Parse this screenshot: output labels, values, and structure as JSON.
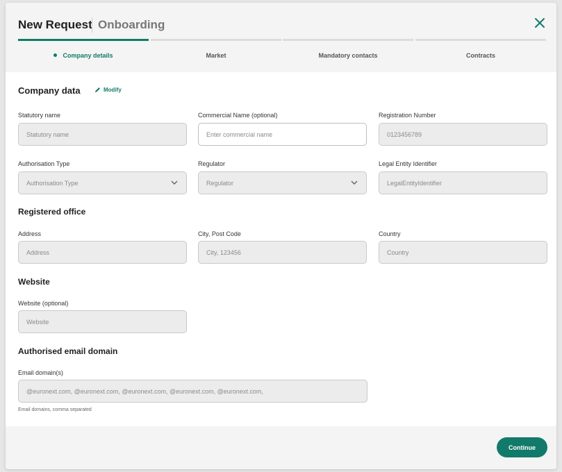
{
  "header": {
    "title": "New Request",
    "subtitle": "Onboarding"
  },
  "steps": [
    {
      "label": "Company details",
      "active": true
    },
    {
      "label": "Market",
      "active": false
    },
    {
      "label": "Mandatory contacts",
      "active": false
    },
    {
      "label": "Contracts",
      "active": false
    }
  ],
  "company": {
    "section_title": "Company data",
    "modify_label": "Modify",
    "statutory_name": {
      "label": "Statutory name",
      "placeholder": "Statutory name"
    },
    "commercial_name": {
      "label": "Commercial Name (optional)",
      "placeholder": "Enter commercial name"
    },
    "registration_number": {
      "label": "Registration Number",
      "value": "0123456789"
    },
    "authorisation_type": {
      "label": "Authorisation Type",
      "value": "Authorisation Type"
    },
    "regulator": {
      "label": "Regulator",
      "value": "Regulator"
    },
    "lei": {
      "label": "Legal Entity Identifier",
      "value": "LegalEntityIdentifier"
    }
  },
  "office": {
    "section_title": "Registered office",
    "address": {
      "label": "Address",
      "placeholder": "Address"
    },
    "city": {
      "label": "City, Post Code",
      "placeholder": "City, 123456"
    },
    "country": {
      "label": "Country",
      "placeholder": "Country"
    }
  },
  "website": {
    "section_title": "Website",
    "field": {
      "label": "Website (optional)",
      "placeholder": "Website"
    }
  },
  "email": {
    "section_title": "Authorised email domain",
    "field": {
      "label": "Email domain(s)",
      "value": "@euronext.com, @euronext.com, @euronext.com, @euronext.com, @euronext.com,"
    },
    "hint": "Email domains, comma separated"
  },
  "footer": {
    "continue_label": "Continue"
  },
  "colors": {
    "accent": "#127a6a",
    "field_bg": "#ececec"
  }
}
